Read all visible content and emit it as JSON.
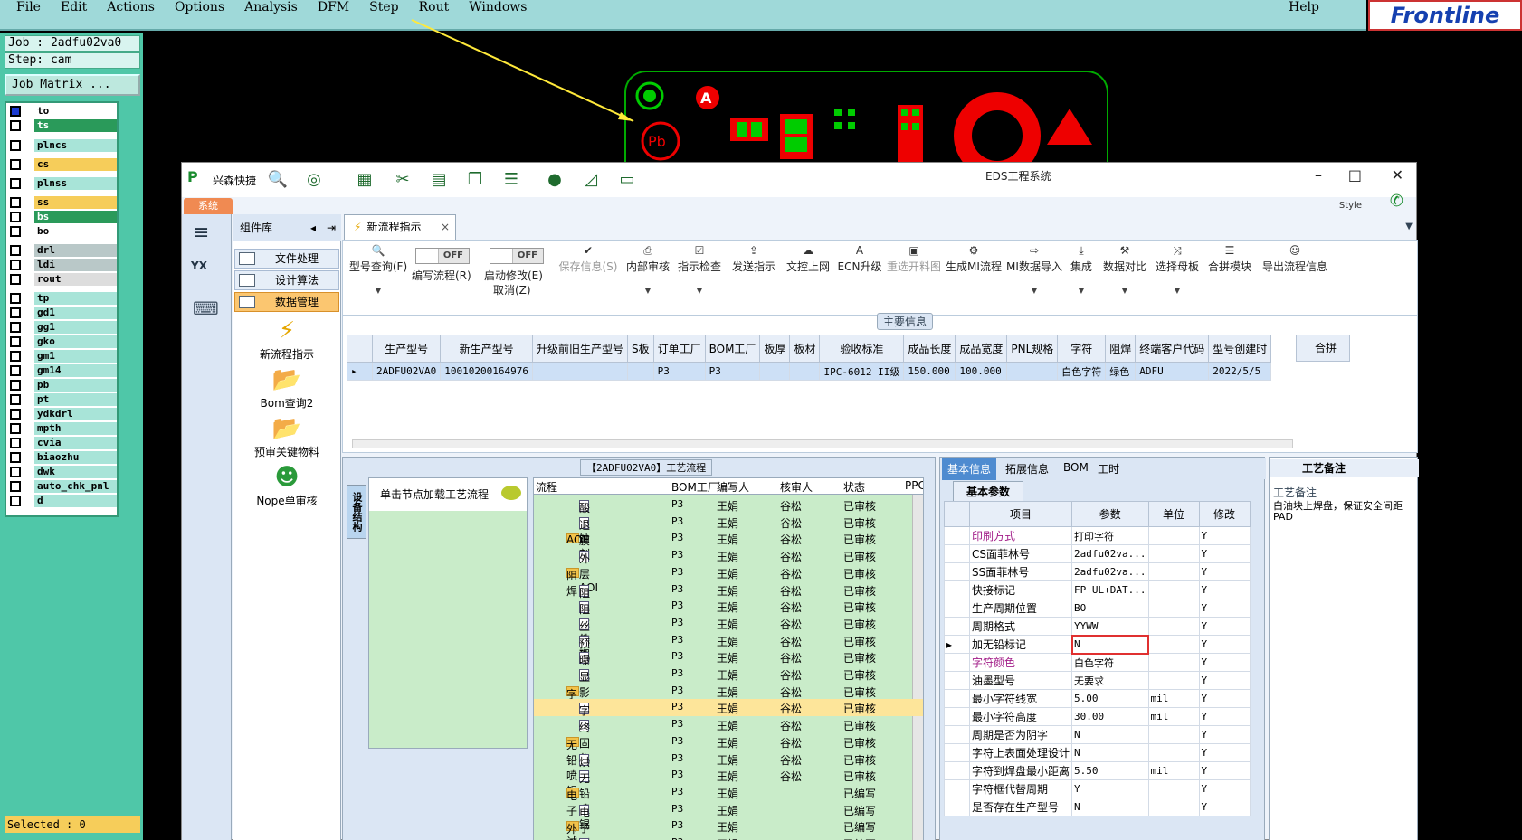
{
  "cam": {
    "menu": [
      "File",
      "Edit",
      "Actions",
      "Options",
      "Analysis",
      "DFM",
      "Step",
      "Rout",
      "Windows"
    ],
    "help": "Help",
    "logo": "Frontline",
    "job": "Job : 2adfu02va0",
    "step": "Step: cam",
    "job_matrix": "Job Matrix ...",
    "layers": [
      "to",
      "ts",
      "plncs",
      "cs",
      "plnss",
      "ss",
      "bs",
      "bo",
      "drl",
      "ldi",
      "rout",
      "tp",
      "gd1",
      "gg1",
      "gko",
      "gm1",
      "gm14",
      "pb",
      "pt",
      "ydkdrl",
      "mpth",
      "cvia",
      "biaozhu",
      "dwk",
      "auto_chk_pnl",
      "d"
    ],
    "selected": "Selected : 0"
  },
  "eds": {
    "brand": "兴森快捷",
    "window_title": "EDS工程系统",
    "style_label": "Style",
    "sys_tab": "系统",
    "complib": {
      "title": "组件库",
      "items": [
        "文件处理",
        "设计算法",
        "数据管理"
      ],
      "big": [
        "新流程指示",
        "Bom查询2",
        "预审关键物料",
        "Nope单审核"
      ]
    },
    "tab": "新流程指示",
    "ribbon": {
      "query": "型号查询(F)",
      "edit_flow": "编写流程(R)",
      "toggle_off": "OFF",
      "start_modify": "启动修改(E)",
      "cancel": "取消(Z)",
      "buttons": [
        "保存信息(S)",
        "内部审核",
        "指示检查",
        "发送指示",
        "文控上网",
        "ECN升级",
        "重选开料图",
        "生成MI流程",
        "MI数据导入",
        "集成",
        "数据对比",
        "选择母板",
        "合拼模块",
        "导出流程信息"
      ]
    },
    "main_section": "主要信息",
    "main_grid": {
      "headers": [
        "生产型号",
        "新生产型号",
        "升级前旧生产型号",
        "S板",
        "订单工厂",
        "BOM工厂",
        "板厚",
        "板材",
        "验收标准",
        "成品长度",
        "成品宽度",
        "PNL规格",
        "字符",
        "阻焊",
        "终端客户代码",
        "型号创建时"
      ],
      "row": [
        "2ADFU02VA0",
        "10010200164976",
        "",
        "",
        "P3",
        "P3",
        "",
        "",
        "IPC-6012 II级",
        "150.000",
        "100.000",
        "",
        "白色字符",
        "绿色",
        "ADFU",
        "2022/5/5"
      ],
      "right_col": "合拼"
    },
    "flow": {
      "title": "【2ADFU02VA0】工艺流程",
      "vtab": "设备结构",
      "hint": "单击节点加载工艺流程",
      "headers": [
        "流程",
        "BOM工厂",
        "编写人",
        "核审人",
        "状态",
        "PPC"
      ],
      "rows": [
        {
          "name": "酸性蚀刻",
          "f": "P3",
          "w": "王娟",
          "c": "谷松",
          "s": "已审核",
          "t": "doc"
        },
        {
          "name": "退膜",
          "f": "P3",
          "w": "王娟",
          "c": "谷松",
          "s": "已审核",
          "t": "doc"
        },
        {
          "name": "AOI",
          "f": "P3",
          "w": "王娟",
          "c": "谷松",
          "s": "已审核",
          "t": "fold"
        },
        {
          "name": "外层AOI",
          "f": "P3",
          "w": "王娟",
          "c": "谷松",
          "s": "已审核",
          "t": "doc"
        },
        {
          "name": "阻焊",
          "f": "P3",
          "w": "王娟",
          "c": "谷松",
          "s": "已审核",
          "t": "fold"
        },
        {
          "name": "阻焊前处理",
          "f": "P3",
          "w": "王娟",
          "c": "谷松",
          "s": "已审核",
          "t": "doc"
        },
        {
          "name": "阻焊塞孔",
          "f": "P3",
          "w": "王娟",
          "c": "谷松",
          "s": "已审核",
          "t": "doc"
        },
        {
          "name": "丝印",
          "f": "P3",
          "w": "王娟",
          "c": "谷松",
          "s": "已审核",
          "t": "doc"
        },
        {
          "name": "预烘",
          "f": "P3",
          "w": "王娟",
          "c": "谷松",
          "s": "已审核",
          "t": "doc"
        },
        {
          "name": "曝光",
          "f": "P3",
          "w": "王娟",
          "c": "谷松",
          "s": "已审核",
          "t": "doc"
        },
        {
          "name": "显影",
          "f": "P3",
          "w": "王娟",
          "c": "谷松",
          "s": "已审核",
          "t": "doc"
        },
        {
          "name": "字符",
          "f": "P3",
          "w": "王娟",
          "c": "谷松",
          "s": "已审核",
          "t": "fold"
        },
        {
          "name": "字符",
          "f": "P3",
          "w": "王娟",
          "c": "谷松",
          "s": "已审核",
          "t": "doc"
        },
        {
          "name": "终固化",
          "f": "P3",
          "w": "王娟",
          "c": "谷松",
          "s": "已审核",
          "t": "doc"
        },
        {
          "name": "无铅喷锡",
          "f": "P3",
          "w": "王娟",
          "c": "谷松",
          "s": "已审核",
          "t": "fold"
        },
        {
          "name": "烘板",
          "f": "P3",
          "w": "王娟",
          "c": "谷松",
          "s": "已审核",
          "t": "doc"
        },
        {
          "name": "无铅喷锡",
          "f": "P3",
          "w": "王娟",
          "c": "谷松",
          "s": "已审核",
          "t": "doc"
        },
        {
          "name": "电子测试",
          "f": "P3",
          "w": "王娟",
          "c": "",
          "s": "已编写",
          "t": "fold"
        },
        {
          "name": "电子测试",
          "f": "P3",
          "w": "王娟",
          "c": "",
          "s": "已编写",
          "t": "doc"
        },
        {
          "name": "外形",
          "f": "P3",
          "w": "王娟",
          "c": "",
          "s": "已编写",
          "t": "fold"
        },
        {
          "name": "铣板",
          "f": "P3",
          "w": "王娟",
          "c": "",
          "s": "已编写",
          "t": "doc"
        }
      ]
    },
    "params": {
      "tabs": [
        "基本信息",
        "拓展信息",
        "BOM",
        "工时"
      ],
      "subtitle": "基本参数",
      "headers": [
        "项目",
        "参数",
        "单位",
        "修改"
      ],
      "rows": [
        {
          "k": "印刷方式",
          "v": "打印字符",
          "u": "",
          "m": "Y",
          "mg": true
        },
        {
          "k": "CS面菲林号",
          "v": "2adfu02va...",
          "u": "",
          "m": "Y"
        },
        {
          "k": "SS面菲林号",
          "v": "2adfu02va...",
          "u": "",
          "m": "Y"
        },
        {
          "k": "快接标记",
          "v": "FP+UL+DAT...",
          "u": "",
          "m": "Y"
        },
        {
          "k": "生产周期位置",
          "v": "BO",
          "u": "",
          "m": "Y"
        },
        {
          "k": "周期格式",
          "v": "YYWW",
          "u": "",
          "m": "Y"
        },
        {
          "k": "加无铅标记",
          "v": "N",
          "u": "",
          "m": "Y",
          "hl": true
        },
        {
          "k": "字符颜色",
          "v": "白色字符",
          "u": "",
          "m": "Y",
          "mg": true
        },
        {
          "k": "油墨型号",
          "v": "无要求",
          "u": "",
          "m": "Y"
        },
        {
          "k": "最小字符线宽",
          "v": "5.00",
          "u": "mil",
          "m": "Y"
        },
        {
          "k": "最小字符高度",
          "v": "30.00",
          "u": "mil",
          "m": "Y"
        },
        {
          "k": "周期是否为阴字",
          "v": "N",
          "u": "",
          "m": "Y"
        },
        {
          "k": "字符上表面处理设计",
          "v": "N",
          "u": "",
          "m": "Y"
        },
        {
          "k": "字符到焊盘最小距离",
          "v": "5.50",
          "u": "mil",
          "m": "Y"
        },
        {
          "k": "字符框代替周期",
          "v": "Y",
          "u": "",
          "m": "Y"
        },
        {
          "k": "是否存在生产型号",
          "v": "N",
          "u": "",
          "m": "Y"
        }
      ]
    },
    "note": {
      "title": "工艺备注",
      "label": "工艺备注",
      "text": "白油块上焊盘，保证安全间距PAD"
    }
  }
}
